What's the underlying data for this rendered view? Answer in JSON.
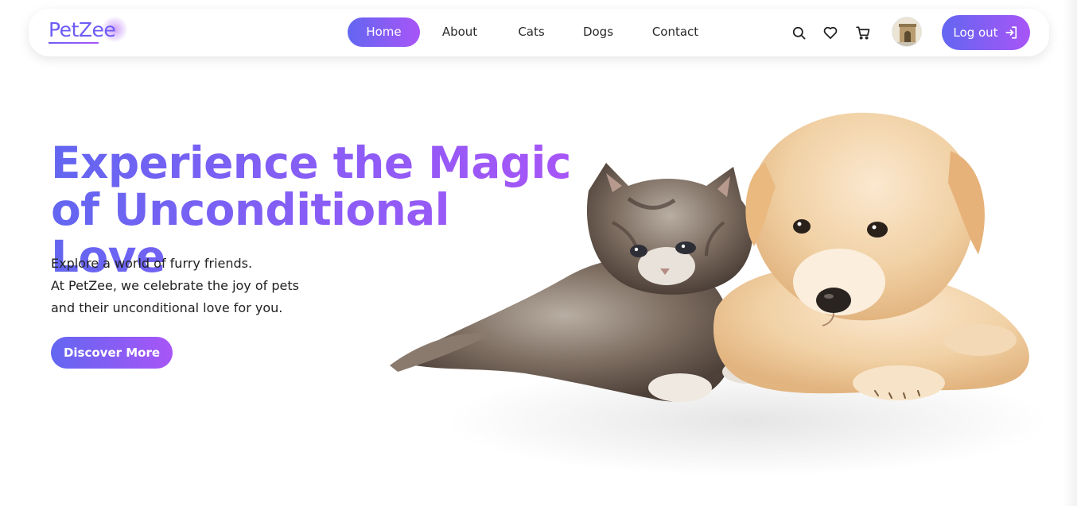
{
  "brand": {
    "name": "PetZee"
  },
  "nav": {
    "links": [
      {
        "label": "Home",
        "active": true
      },
      {
        "label": "About",
        "active": false
      },
      {
        "label": "Cats",
        "active": false
      },
      {
        "label": "Dogs",
        "active": false
      },
      {
        "label": "Contact",
        "active": false
      }
    ],
    "icons": [
      "search-icon",
      "heart-icon",
      "cart-icon"
    ],
    "logout_label": "Log out"
  },
  "hero": {
    "headline_line1": "Experience the Magic",
    "headline_line2": "of Unconditional Love",
    "sub_line1": "Explore a world of furry friends.",
    "sub_line2": "At PetZee, we celebrate the joy of pets",
    "sub_line3": "and their unconditional love for you.",
    "cta_label": "Discover More"
  },
  "colors": {
    "gradient_start": "#6366f1",
    "gradient_end": "#a855f7",
    "text": "#222222",
    "background": "#ffffff"
  }
}
